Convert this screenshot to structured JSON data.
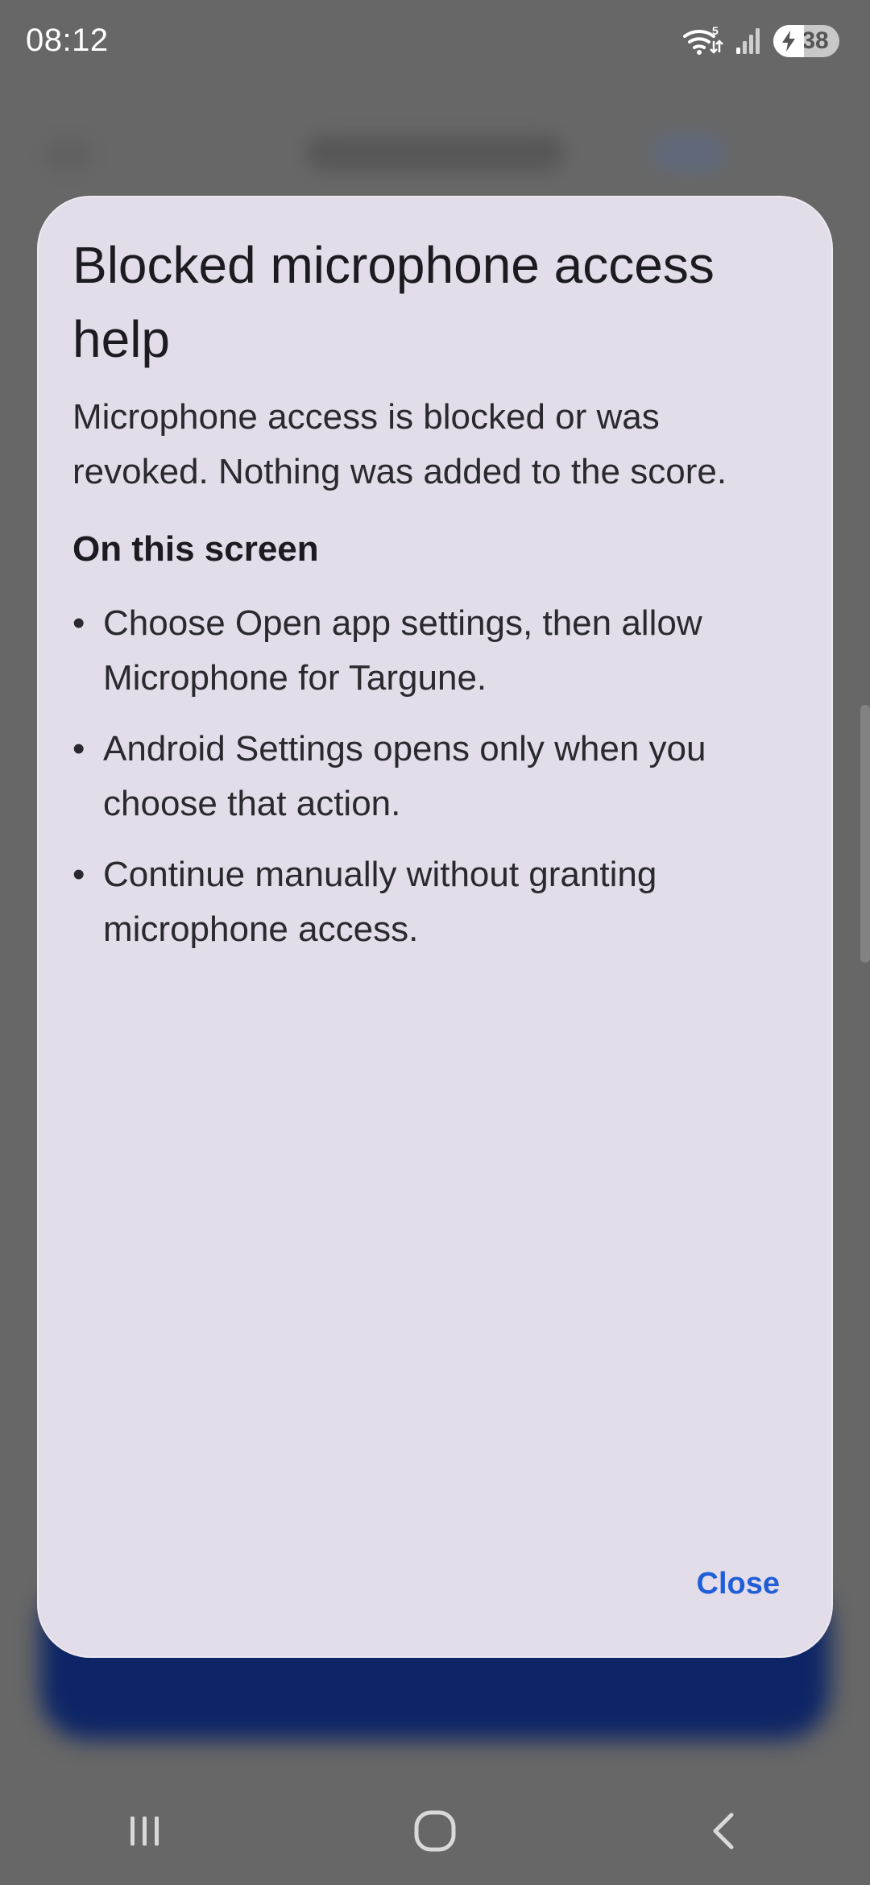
{
  "status_bar": {
    "time": "08:12",
    "wifi_badge": "5",
    "battery_level": "38"
  },
  "dialog": {
    "title": "Blocked microphone access help",
    "body": "Microphone access is blocked or was revoked. Nothing was added to the score.",
    "section_heading": "On this screen",
    "bullets": [
      "Choose Open app settings, then allow Microphone for Targune.",
      "Android Settings opens only when you choose that action.",
      "Continue manually without granting microphone access."
    ],
    "close_label": "Close"
  },
  "nav_bar": {
    "icons": [
      "recents-icon",
      "home-icon",
      "back-icon"
    ]
  },
  "colors": {
    "dialog_bg": "#e2dde8",
    "accent": "#1f5ed8",
    "scrim": "#676767",
    "bottom_button_bg": "#0d2566"
  }
}
